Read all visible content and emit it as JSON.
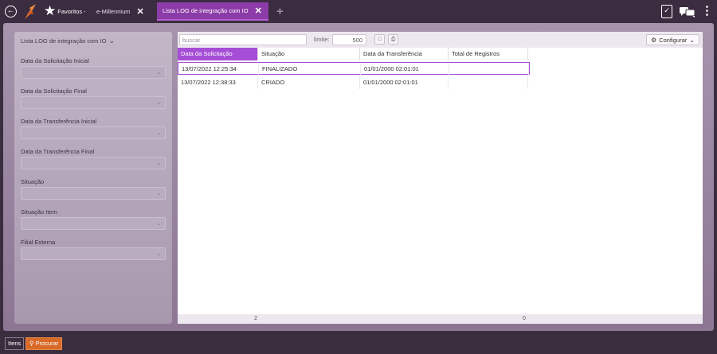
{
  "topbar": {
    "favorites_label": "Favoritos -",
    "tab1_label": "e-Millennium",
    "tab2_label": "Lista LOG de integração com IO"
  },
  "filters": {
    "title": "Lista LOG de integração com IO",
    "fields": [
      {
        "label": "Data da Solicitação Inicial"
      },
      {
        "label": "Data da Solicitação Final"
      },
      {
        "label": "Data da Transferência Inicial"
      },
      {
        "label": "Data da Transferência Final"
      },
      {
        "label": "Situação"
      },
      {
        "label": "Situação Item"
      },
      {
        "label": "Filial Externa"
      }
    ]
  },
  "toolbar": {
    "search_placeholder": "buscar",
    "limit_label": "limite:",
    "limit_value": "500",
    "config_label": "Configurar"
  },
  "grid": {
    "columns": [
      "Data da Solicitação",
      "Situação",
      "Data da Transferência",
      "Total de Registros"
    ],
    "rows": [
      [
        "13/07/2022 12:25:34",
        "FINALIZADO",
        "01/01/2000 02:01:01",
        ""
      ],
      [
        "13/07/2022 12:38:33",
        "CRIADO",
        "01/01/2000 02:01:01",
        ""
      ]
    ],
    "footer_count": "2",
    "footer_total": "0"
  },
  "bottom": {
    "items_label": "Itens",
    "procurar_label": "Procurar"
  },
  "colors": {
    "accent": "#a64ed6",
    "tab_active": "#8c3ca8",
    "procurar": "#d86a28"
  }
}
